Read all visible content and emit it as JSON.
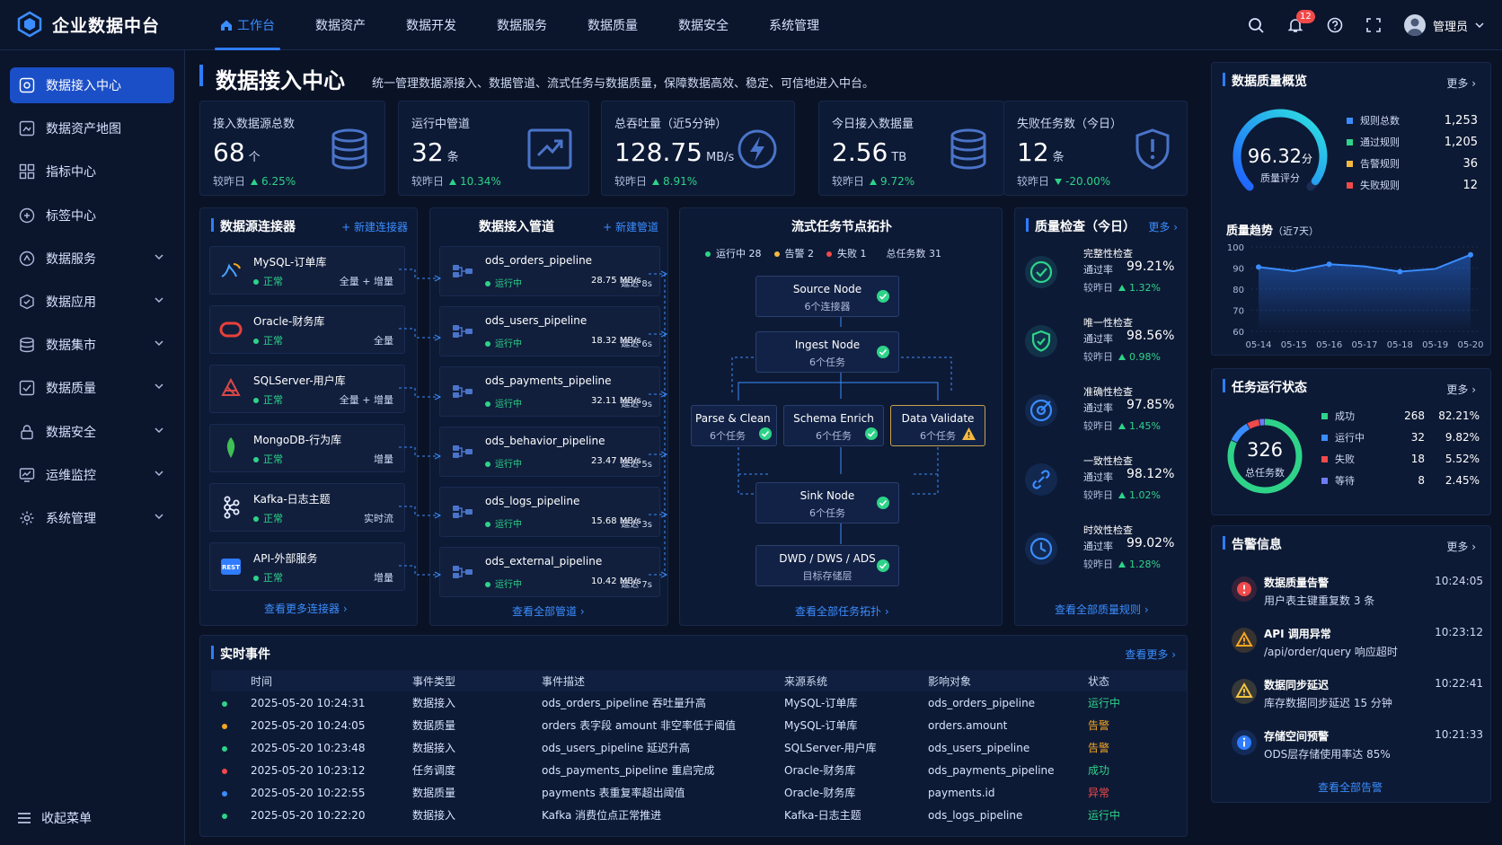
{
  "app": {
    "title": "企业数据中台"
  },
  "topnav": [
    {
      "label": "工作台",
      "active": true
    },
    {
      "label": "数据资产"
    },
    {
      "label": "数据开发"
    },
    {
      "label": "数据服务"
    },
    {
      "label": "数据质量"
    },
    {
      "label": "数据安全"
    },
    {
      "label": "系统管理"
    }
  ],
  "header": {
    "notification_count": "12",
    "user_name": "管理员"
  },
  "sidebar": {
    "items": [
      {
        "label": "数据接入中心",
        "icon": "access-icon",
        "active": true
      },
      {
        "label": "数据资产地图",
        "icon": "map-icon"
      },
      {
        "label": "指标中心",
        "icon": "metric-icon"
      },
      {
        "label": "标签中心",
        "icon": "tag-icon"
      },
      {
        "label": "数据服务",
        "icon": "service-icon",
        "expandable": true
      },
      {
        "label": "数据应用",
        "icon": "app-icon",
        "expandable": true
      },
      {
        "label": "数据集市",
        "icon": "mart-icon",
        "expandable": true
      },
      {
        "label": "数据质量",
        "icon": "quality-icon",
        "expandable": true
      },
      {
        "label": "数据安全",
        "icon": "lock-icon",
        "expandable": true
      },
      {
        "label": "运维监控",
        "icon": "monitor-icon",
        "expandable": true
      },
      {
        "label": "系统管理",
        "icon": "gear-icon",
        "expandable": true
      }
    ],
    "collapse_label": "收起菜单"
  },
  "page": {
    "title": "数据接入中心",
    "description": "统一管理数据源接入、数据管道、流式任务与数据质量，保障数据高效、稳定、可信地进入中台。"
  },
  "stats": [
    {
      "label": "接入数据源总数",
      "value": "68",
      "unit": "个",
      "compare_label": "较昨日",
      "change": "6.25%",
      "direction": "up",
      "icon": "database-icon"
    },
    {
      "label": "运行中管道",
      "value": "32",
      "unit": "条",
      "compare_label": "较昨日",
      "change": "10.34%",
      "direction": "up",
      "icon": "pipeline-icon"
    },
    {
      "label": "总吞吐量（近5分钟）",
      "value": "128.75",
      "unit": "MB/s",
      "compare_label": "较昨日",
      "change": "8.91%",
      "direction": "up",
      "icon": "gauge-icon"
    },
    {
      "label": "今日接入数据量",
      "value": "2.56",
      "unit": "TB",
      "compare_label": "较昨日",
      "change": "9.72%",
      "direction": "up",
      "icon": "database-icon"
    },
    {
      "label": "失败任务数（今日）",
      "value": "12",
      "unit": "条",
      "compare_label": "较昨日",
      "change": "-20.00%",
      "direction": "down",
      "icon": "shield-icon"
    }
  ],
  "connectors": {
    "title": "数据源连接器",
    "add_label": "+ 新建连接器",
    "more_label": "查看更多连接器 ›",
    "items": [
      {
        "name": "MySQL-订单库",
        "status": "正常",
        "mode": "全量 + 增量",
        "icon": "mysql-icon",
        "color": "#4aa3ff"
      },
      {
        "name": "Oracle-财务库",
        "status": "正常",
        "mode": "全量",
        "icon": "oracle-icon",
        "color": "#e8403a"
      },
      {
        "name": "SQLServer-用户库",
        "status": "正常",
        "mode": "全量 + 增量",
        "icon": "sqlserver-icon",
        "color": "#d84848"
      },
      {
        "name": "MongoDB-行为库",
        "status": "正常",
        "mode": "增量",
        "icon": "mongodb-icon",
        "color": "#3fbf55"
      },
      {
        "name": "Kafka-日志主题",
        "status": "正常",
        "mode": "实时流",
        "icon": "kafka-icon",
        "color": "#e6ecff"
      },
      {
        "name": "API-外部服务",
        "status": "正常",
        "mode": "增量",
        "icon": "api-icon",
        "color": "#2f7cff"
      }
    ]
  },
  "pipelines": {
    "title": "数据接入管道",
    "add_label": "+ 新建管道",
    "more_label": "查看全部管道 ›",
    "items": [
      {
        "name": "ods_orders_pipeline",
        "status": "运行中",
        "rate": "28.75 MB/s",
        "delay": "延迟 8s"
      },
      {
        "name": "ods_users_pipeline",
        "status": "运行中",
        "rate": "18.32 MB/s",
        "delay": "延迟 6s"
      },
      {
        "name": "ods_payments_pipeline",
        "status": "运行中",
        "rate": "32.11 MB/s",
        "delay": "延迟 9s"
      },
      {
        "name": "ods_behavior_pipeline",
        "status": "运行中",
        "rate": "23.47 MB/s",
        "delay": "延迟 5s"
      },
      {
        "name": "ods_logs_pipeline",
        "status": "运行中",
        "rate": "15.68 MB/s",
        "delay": "延迟 3s"
      },
      {
        "name": "ods_external_pipeline",
        "status": "运行中",
        "rate": "10.42 MB/s",
        "delay": "延迟 7s"
      }
    ]
  },
  "topology": {
    "title": "流式任务节点拓扑",
    "legend": {
      "running": "运行中 28",
      "warning": "告警 2",
      "failed": "失败 1",
      "total": "总任务数 31"
    },
    "nodes": {
      "source": {
        "title": "Source Node",
        "sub": "6个连接器"
      },
      "ingest": {
        "title": "Ingest Node",
        "sub": "6个任务"
      },
      "parse": {
        "title": "Parse & Clean",
        "sub": "6个任务"
      },
      "enrich": {
        "title": "Schema Enrich",
        "sub": "6个任务"
      },
      "validate": {
        "title": "Data Validate",
        "sub": "6个任务"
      },
      "sink": {
        "title": "Sink Node",
        "sub": "6个任务"
      },
      "dwd": {
        "title": "DWD / DWS / ADS",
        "sub": "目标存储层"
      }
    },
    "more_label": "查看全部任务拓扑 ›"
  },
  "quality_check": {
    "title": "质量检查（今日）",
    "more_label": "更多 ›",
    "footer_label": "查看全部质量规则 ›",
    "items": [
      {
        "name": "完整性检查",
        "rate_label": "通过率",
        "rate": "99.21%",
        "compare_label": "较昨日",
        "change": "1.32%",
        "icon": "check-circle-icon"
      },
      {
        "name": "唯一性检查",
        "rate_label": "通过率",
        "rate": "98.56%",
        "compare_label": "较昨日",
        "change": "0.98%",
        "icon": "shield-check-icon"
      },
      {
        "name": "准确性检查",
        "rate_label": "通过率",
        "rate": "97.85%",
        "compare_label": "较昨日",
        "change": "1.45%",
        "icon": "target-icon"
      },
      {
        "name": "一致性检查",
        "rate_label": "通过率",
        "rate": "98.12%",
        "compare_label": "较昨日",
        "change": "1.02%",
        "icon": "link-icon"
      },
      {
        "name": "时效性检查",
        "rate_label": "通过率",
        "rate": "99.02%",
        "compare_label": "较昨日",
        "change": "1.28%",
        "icon": "clock-icon"
      }
    ]
  },
  "quality_overview": {
    "title": "数据质量概览",
    "more_label": "更多 ›",
    "score": "96.32",
    "score_unit": "分",
    "score_label": "质量评分",
    "score_fraction": 0.9632,
    "legend": [
      {
        "label": "规则总数",
        "value": "1,253",
        "color": "#3a8dff"
      },
      {
        "label": "通过规则",
        "value": "1,205",
        "color": "#2ed389"
      },
      {
        "label": "告警规则",
        "value": "36",
        "color": "#f5b942"
      },
      {
        "label": "失败规则",
        "value": "12",
        "color": "#f04a4a"
      }
    ],
    "trend_title": "质量趋势",
    "trend_subtitle": "（近7天）"
  },
  "chart_data": {
    "type": "line",
    "title": "质量趋势",
    "x": [
      "05-14",
      "05-15",
      "05-16",
      "05-17",
      "05-18",
      "05-19",
      "05-20"
    ],
    "y_ticks": [
      100,
      90,
      80,
      70,
      60
    ],
    "ylim": [
      60,
      100
    ],
    "series": [
      {
        "values": [
          90.5,
          88.5,
          91.8,
          90.8,
          88.3,
          89.6,
          96.3
        ]
      }
    ],
    "grid": true,
    "area": true
  },
  "task_status": {
    "title": "任务运行状态",
    "more_label": "更多 ›",
    "total": "326",
    "total_label": "总任务数",
    "items": [
      {
        "label": "成功",
        "count": "268",
        "percent": "82.21%",
        "fraction": 0.8221,
        "color": "#2ed389"
      },
      {
        "label": "运行中",
        "count": "32",
        "percent": "9.82%",
        "fraction": 0.0982,
        "color": "#3a8dff"
      },
      {
        "label": "失败",
        "count": "18",
        "percent": "5.52%",
        "fraction": 0.0552,
        "color": "#f04a4a"
      },
      {
        "label": "等待",
        "count": "8",
        "percent": "2.45%",
        "fraction": 0.0245,
        "color": "#6d7cf5"
      }
    ]
  },
  "alerts": {
    "title": "告警信息",
    "more_label": "更多 ›",
    "footer_label": "查看全部告警",
    "items": [
      {
        "title": "数据质量告警",
        "desc": "用户表主键重复数 3 条",
        "time": "10:24:05",
        "icon": "error-icon",
        "color": "#f04a4a"
      },
      {
        "title": "API 调用异常",
        "desc": "/api/order/query 响应超时",
        "time": "10:23:12",
        "icon": "warning-icon",
        "color": "#f5a623"
      },
      {
        "title": "数据同步延迟",
        "desc": "库存数据同步延迟 15 分钟",
        "time": "10:22:41",
        "icon": "warning-icon",
        "color": "#f5c542"
      },
      {
        "title": "存储空间预警",
        "desc": "ODS层存储使用率达 85%",
        "time": "10:21:33",
        "icon": "info-icon",
        "color": "#2f7cff"
      }
    ]
  },
  "events": {
    "title": "实时事件",
    "more_label": "查看更多 ›",
    "columns": [
      "时间",
      "事件类型",
      "事件描述",
      "来源系统",
      "影响对象",
      "状态"
    ],
    "rows": [
      {
        "dot": "#2ed389",
        "time": "2025-05-20 10:24:31",
        "type": "数据接入",
        "desc": "ods_orders_pipeline 吞吐量升高",
        "source": "MySQL-订单库",
        "target": "ods_orders_pipeline",
        "status": "运行中",
        "status_color": "#2ed389"
      },
      {
        "dot": "#f5a623",
        "time": "2025-05-20 10:24:05",
        "type": "数据质量",
        "desc": "orders 表字段 amount 非空率低于阈值",
        "source": "MySQL-订单库",
        "target": "orders.amount",
        "status": "告警",
        "status_color": "#f5a623"
      },
      {
        "dot": "#2ed389",
        "time": "2025-05-20 10:23:48",
        "type": "数据接入",
        "desc": "ods_users_pipeline 延迟升高",
        "source": "SQLServer-用户库",
        "target": "ods_users_pipeline",
        "status": "告警",
        "status_color": "#f5a623"
      },
      {
        "dot": "#f04a4a",
        "time": "2025-05-20 10:23:12",
        "type": "任务调度",
        "desc": "ods_payments_pipeline 重启完成",
        "source": "Oracle-财务库",
        "target": "ods_payments_pipeline",
        "status": "成功",
        "status_color": "#2ed389"
      },
      {
        "dot": "#3a8dff",
        "time": "2025-05-20 10:22:55",
        "type": "数据质量",
        "desc": "payments 表重复率超出阈值",
        "source": "Oracle-财务库",
        "target": "payments.id",
        "status": "异常",
        "status_color": "#f04a4a"
      },
      {
        "dot": "#2ed389",
        "time": "2025-05-20 10:22:20",
        "type": "数据接入",
        "desc": "Kafka 消费位点正常推进",
        "source": "Kafka-日志主题",
        "target": "ods_logs_pipeline",
        "status": "运行中",
        "status_color": "#2ed389"
      }
    ]
  }
}
